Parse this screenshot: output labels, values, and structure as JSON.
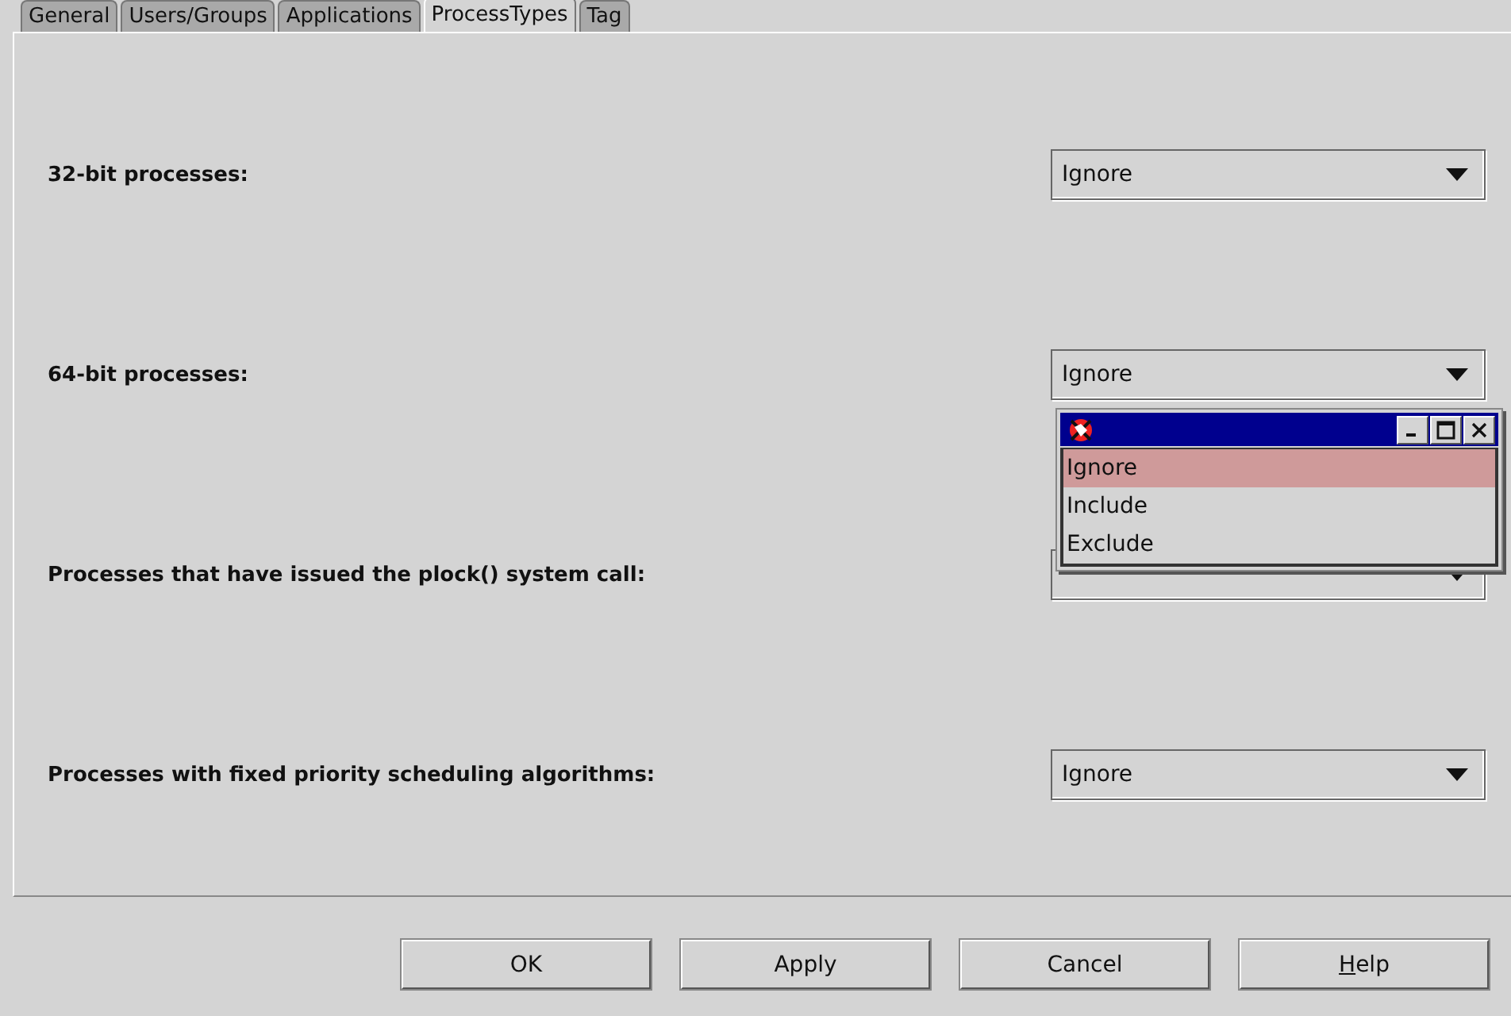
{
  "tabs": [
    {
      "label": "General",
      "selected": false
    },
    {
      "label": "Users/Groups",
      "selected": false
    },
    {
      "label": "Applications",
      "selected": false
    },
    {
      "label": "ProcessTypes",
      "selected": true
    },
    {
      "label": "Tag",
      "selected": false
    }
  ],
  "rows": [
    {
      "label": "32-bit processes:",
      "value": "Ignore"
    },
    {
      "label": "64-bit processes:",
      "value": "Ignore"
    },
    {
      "label": "Processes that have issued the plock() system call:"
    },
    {
      "label": "Processes with fixed priority scheduling algorithms:",
      "value": "Ignore"
    }
  ],
  "popup": {
    "options": [
      {
        "label": "Ignore",
        "selected": true
      },
      {
        "label": "Include",
        "selected": false
      },
      {
        "label": "Exclude",
        "selected": false
      }
    ]
  },
  "buttons": [
    {
      "label": "OK",
      "underline_first_letter": false
    },
    {
      "label": "Apply",
      "underline_first_letter": false
    },
    {
      "label": "Cancel",
      "underline_first_letter": false
    },
    {
      "label": "Help",
      "underline_first_letter": true
    }
  ]
}
